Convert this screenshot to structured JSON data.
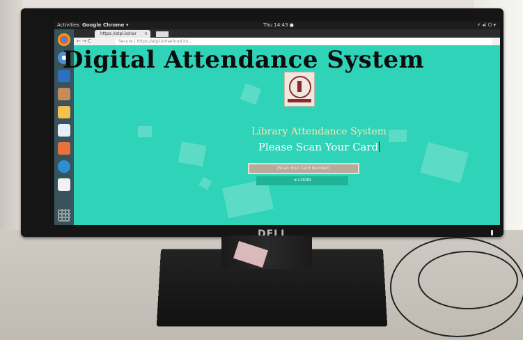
{
  "overlay_title": "Digital Attendance System",
  "topbar": {
    "activities": "Activities",
    "app": "Google Chrome ▾",
    "clock": "Thu 14:43 ●",
    "tray": "⚡ ◂) ⏻ ▾"
  },
  "browser": {
    "tab_title": "https://atpl.kohar",
    "tab_close": "×",
    "nav": "← → C",
    "url": "Secure | https://atpl.koharloud.in/…"
  },
  "page": {
    "library_title": "Library Attendance System",
    "scan_prompt": "Please Scan Your Card",
    "card_placeholder": "[Scan Your Card Number]",
    "login_label": "➜ LOGIN"
  },
  "monitor_brand": "DELL",
  "colors": {
    "screen": "#2fd3b8",
    "login": "#1fb496",
    "title_text": "#f3e6b3"
  }
}
